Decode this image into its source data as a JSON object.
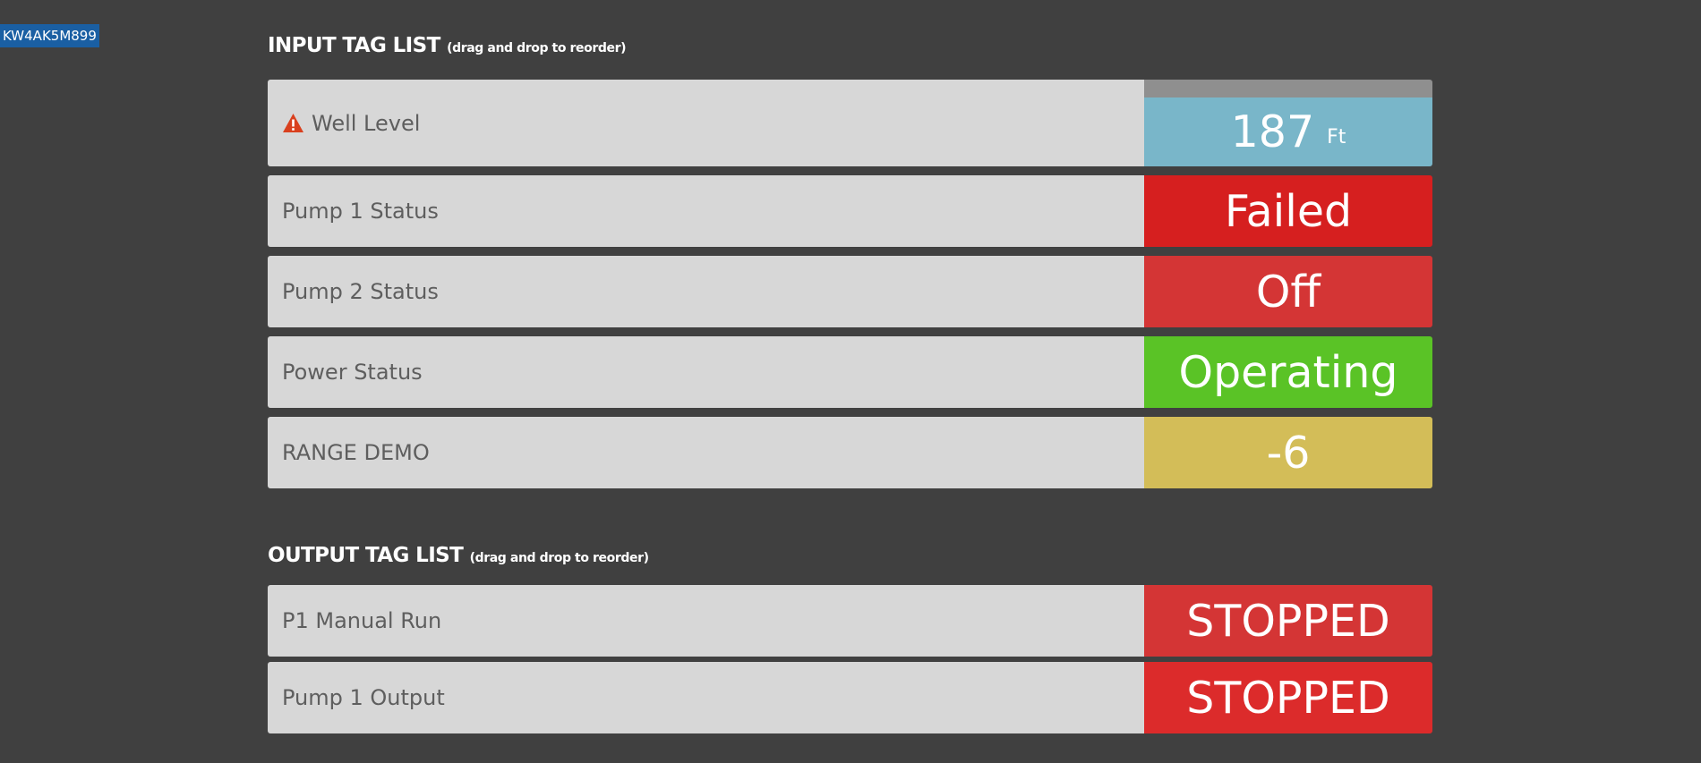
{
  "device": {
    "id": "KW4AK5M899"
  },
  "input_section": {
    "title": "INPUT TAG LIST",
    "hint": "(drag and drop to reorder)",
    "rows": [
      {
        "label": "Well Level",
        "value": "187",
        "unit": "Ft",
        "icon": "warning-triangle-icon",
        "color": "#79b6c9"
      },
      {
        "label": "Pump 1 Status",
        "value": "Failed",
        "color": "#d61f1f"
      },
      {
        "label": "Pump 2 Status",
        "value": "Off",
        "color": "#d43535"
      },
      {
        "label": "Power Status",
        "value": "Operating",
        "color": "#5ac326"
      },
      {
        "label": "RANGE DEMO",
        "value": "-6",
        "color": "#d3bd58"
      }
    ]
  },
  "output_section": {
    "title": "OUTPUT TAG LIST",
    "hint": "(drag and drop to reorder)",
    "rows": [
      {
        "label": "P1 Manual Run",
        "value": "STOPPED",
        "color": "#d43535"
      },
      {
        "label": "Pump 1 Output",
        "value": "STOPPED",
        "color": "#dc2b2b"
      }
    ]
  },
  "colors": {
    "background": "#404040",
    "row_label_bg": "#d7d7d7",
    "badge_bg": "#1a5fa3",
    "warning_icon": "#d9401e"
  }
}
